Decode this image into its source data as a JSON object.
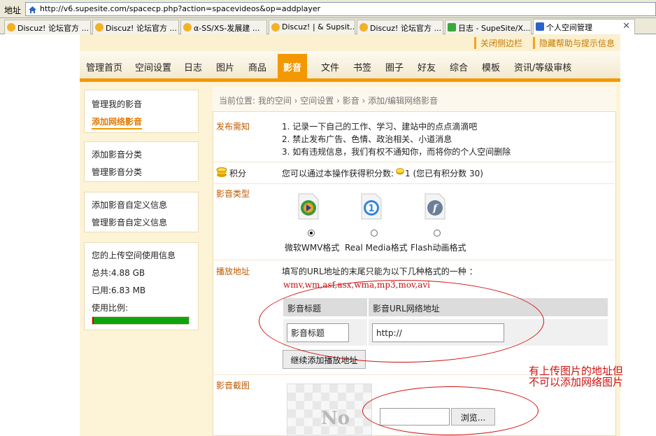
{
  "browser": {
    "address_label": "地址",
    "url": "http://v6.supesite.com/spacecp.php?action=spacevideos&op=addplayer",
    "tabs": [
      {
        "label": "Discuz! 论坛官方 ..."
      },
      {
        "label": "Discuz! 论坛官方 ..."
      },
      {
        "label": "α-SS/XS-发展建 ..."
      },
      {
        "label": "Discuz! | & Supsit..."
      },
      {
        "label": "Discuz! 论坛官方 ..."
      },
      {
        "label": "日志 - SupeSite/X..."
      },
      {
        "label": "个人空间管理"
      }
    ],
    "close": "✕"
  },
  "toplinks": {
    "close_sidebar": "关闭侧边栏",
    "hide_help": "隐藏帮助与提示信息"
  },
  "nav": [
    "管理首页",
    "空间设置",
    "日志",
    "图片",
    "商品",
    "影音",
    "文件",
    "书签",
    "圈子",
    "好友",
    "综合",
    "模板",
    "资讯/等级审核"
  ],
  "sidebar": {
    "group1": [
      "管理我的影音",
      "添加网络影音"
    ],
    "group2": [
      "添加影音分类",
      "管理影音分类"
    ],
    "group3": [
      "添加影音自定义信息",
      "管理影音自定义信息"
    ],
    "usage": {
      "title": "您的上传空间使用信息",
      "total": "总共:4.88 GB",
      "used": "已用:6.83 MB",
      "ratio": "使用比例:"
    }
  },
  "breadcrumb": "当前位置: 我的空间 › 空间设置 › 影音 › 添加/编辑网络影音",
  "notice": {
    "label": "发布需知",
    "lines": [
      "1. 记录一下自己的工作、学习、建站中的点点滴滴吧",
      "2. 禁止发布广告、色情、政治相关、小道消息",
      "3. 如有违规信息，我们有权不通知你，而将你的个人空间删除"
    ]
  },
  "credits": {
    "label": "积分",
    "text": "您可以通过本操作获得积分数:",
    "value": "1 (您已有积分数 30)"
  },
  "video_type": {
    "label": "影音类型",
    "options": [
      {
        "label": "微软WMV格式",
        "icon": "wmv-icon"
      },
      {
        "label": "Real Media格式",
        "icon": "real-media-icon"
      },
      {
        "label": "Flash动画格式",
        "icon": "flash-icon"
      }
    ],
    "selected": 0
  },
  "play_url": {
    "label": "播放地址",
    "hint": "填写的URL地址的末尾只能为以下几种格式的一种 ：",
    "formats": "wmv,wm,asf,asx,wma,mp3,mov,avi",
    "col_title": "影音标题",
    "col_url": "影音URL网络地址",
    "title_value": "影音标题",
    "url_value": "http://",
    "add_button": "继续添加播放地址"
  },
  "screenshot": {
    "label": "影音截图",
    "browse_button": "浏览...",
    "thumb_text": "No"
  },
  "annotation": {
    "line1": "有上传图片的地址但",
    "line2": "不可以添加网络图片"
  },
  "colors": {
    "accent": "#f39800",
    "annotation": "#d01010",
    "label": "#c05a00"
  }
}
